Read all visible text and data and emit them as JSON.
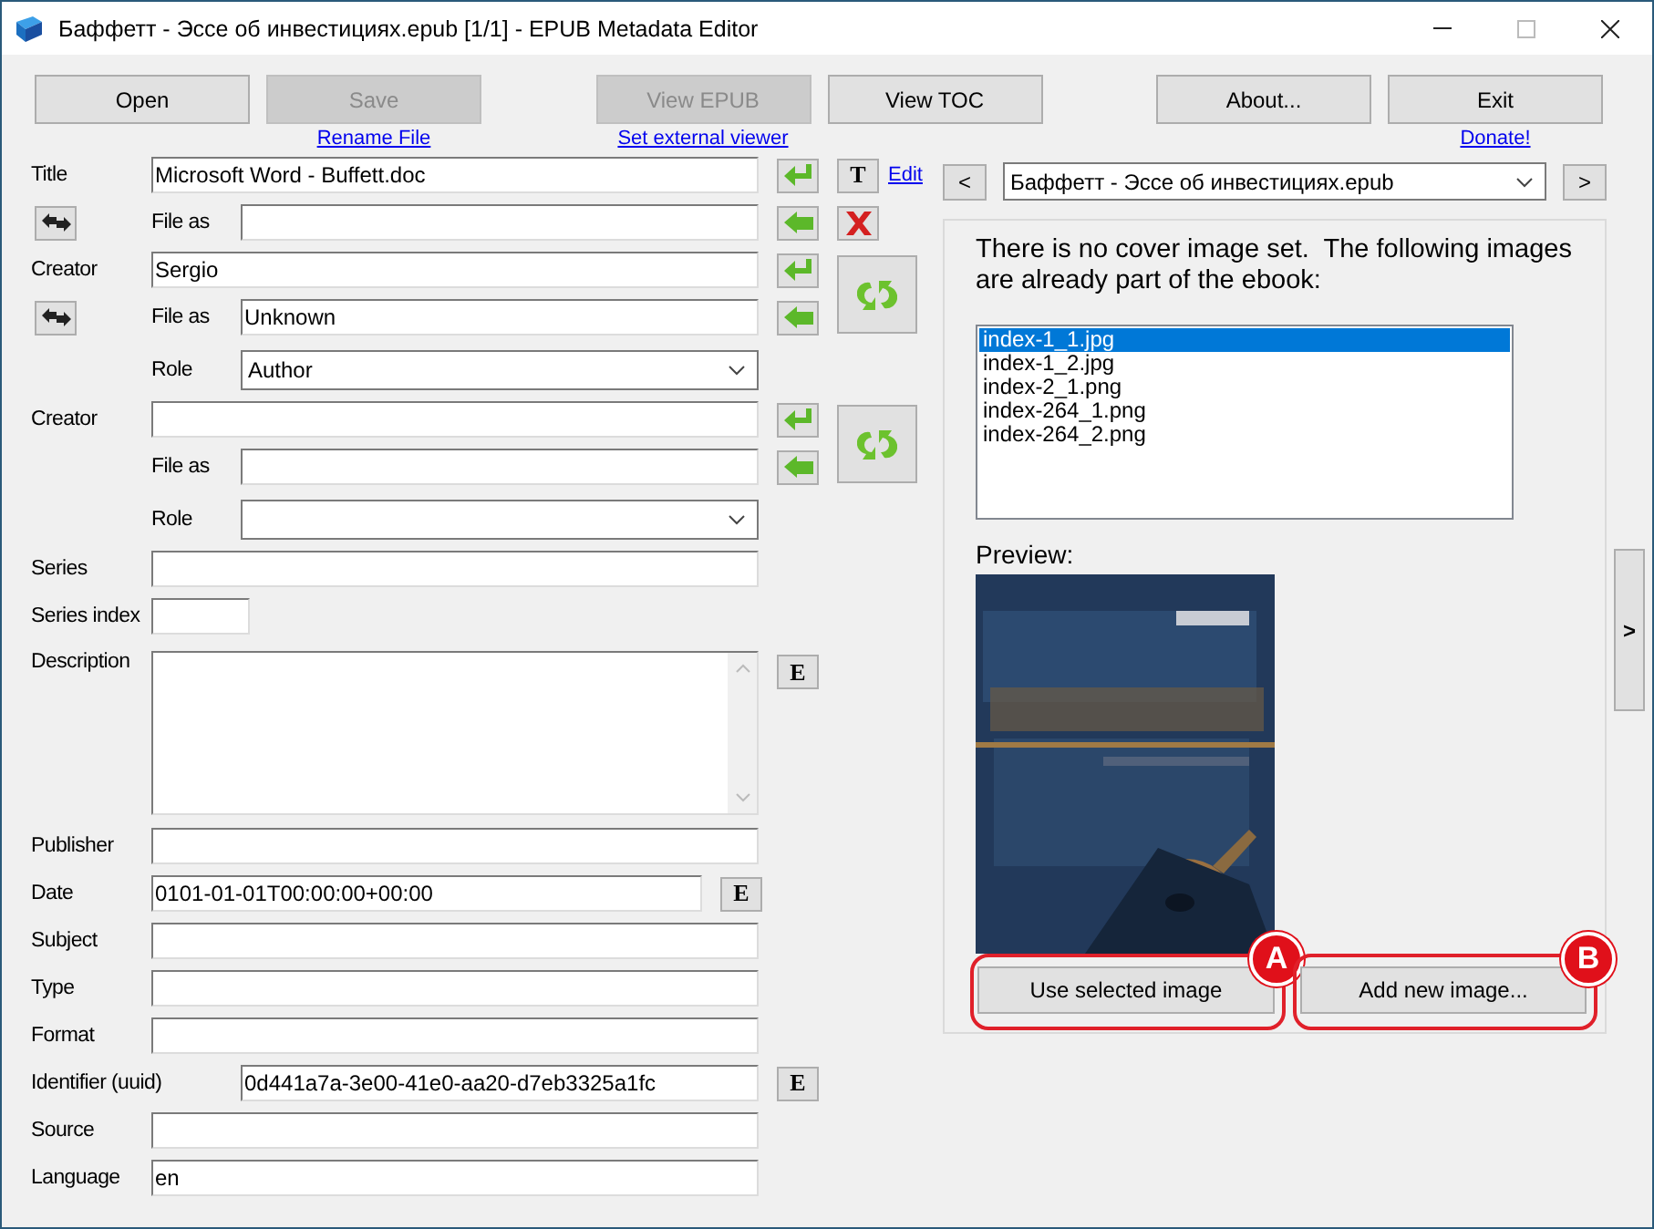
{
  "window": {
    "title": "Баффетт - Эссе об инвестициях.epub [1/1] - EPUB Metadata Editor"
  },
  "toolbar": [
    [
      {
        "label": "Open",
        "disabled": false
      },
      {
        "label": "Save",
        "disabled": true,
        "link": "Rename File"
      }
    ],
    [
      {
        "label": "View EPUB",
        "disabled": true,
        "link": "Set external viewer"
      },
      {
        "label": "View TOC",
        "disabled": false
      }
    ],
    [
      {
        "label": "About...",
        "disabled": false
      },
      {
        "label": "Exit",
        "disabled": false,
        "link": "Donate!"
      }
    ]
  ],
  "title": {
    "label": "Title",
    "value": "Microsoft Word - Buffett.doc",
    "file_as_label": "File as",
    "format_button": "T",
    "edit_link": "Edit"
  },
  "creators": [
    {
      "label": "Creator",
      "value": "Sergio",
      "file_as_label": "File as",
      "file_as": "Unknown",
      "role_label": "Role",
      "role": "Author"
    },
    {
      "label": "Creator",
      "file_as_label": "File as",
      "role_label": "Role"
    }
  ],
  "fields": [
    {
      "kind": "wide",
      "label": "Series"
    },
    {
      "kind": "short",
      "label": "Series index"
    },
    {
      "kind": "memo",
      "label": "Description",
      "button": "E"
    },
    {
      "kind": "wide",
      "label": "Publisher"
    },
    {
      "kind": "narrow",
      "label": "Date",
      "value": "0101-01-01T00:00:00+00:00",
      "button": "E"
    },
    {
      "kind": "wide",
      "label": "Subject"
    },
    {
      "kind": "wide",
      "label": "Type"
    },
    {
      "kind": "wide",
      "label": "Format"
    },
    {
      "kind": "indented",
      "label": "Identifier (uuid)",
      "value": "0d441a7a-3e00-41e0-aa20-d7eb3325a1fc",
      "button": "E"
    },
    {
      "kind": "wide",
      "label": "Source"
    },
    {
      "kind": "wide",
      "label": "Language",
      "value": "en"
    }
  ],
  "navigator": {
    "prev": "<",
    "file": "Баффетт - Эссе об инвестициях.epub",
    "next": ">"
  },
  "cover": {
    "message": "There is no cover image set.  The following images are already part of the ebook:",
    "images": [
      {
        "name": "index-1_1.jpg",
        "selected": true
      },
      {
        "name": "index-1_2.jpg",
        "selected": false
      },
      {
        "name": "index-2_1.png",
        "selected": false
      },
      {
        "name": "index-264_1.png",
        "selected": false
      },
      {
        "name": "index-264_2.png",
        "selected": false
      }
    ],
    "preview_label": "Preview:",
    "buttons": [
      {
        "label": "Use selected image",
        "callout": "A"
      },
      {
        "label": "Add new image...",
        "callout": "B"
      }
    ]
  },
  "side_toggle": ">"
}
